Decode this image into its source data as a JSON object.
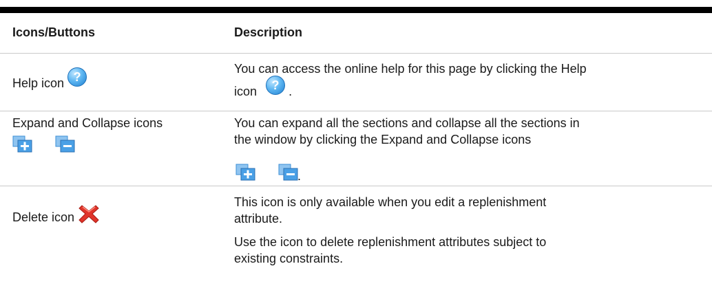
{
  "table": {
    "headers": [
      "Icons/Buttons",
      "Description"
    ],
    "rows": [
      {
        "label": "Help icon",
        "icons": [
          "help-icon"
        ],
        "desc_lines": [
          "You can access the online help for this page by clicking the Help",
          "icon",
          "."
        ]
      },
      {
        "label": "Expand and Collapse icons",
        "icons": [
          "expand-icon",
          "collapse-icon"
        ],
        "desc_lines": [
          "You can expand all the sections and collapse all the sections in",
          "the window by clicking the Expand and Collapse icons",
          "."
        ]
      },
      {
        "label": "Delete icon",
        "icons": [
          "delete-icon"
        ],
        "desc_paragraphs": [
          "This icon is only available when you edit a replenishment",
          "attribute.",
          "Use the icon to delete replenishment attributes subject to",
          "existing constraints."
        ]
      }
    ],
    "colors": {
      "help_icon": "#3a9be0",
      "expand_collapse_icon": "#3d8fd6",
      "delete_icon": "#e0342a",
      "row_divider": "#c9c9c9"
    }
  }
}
